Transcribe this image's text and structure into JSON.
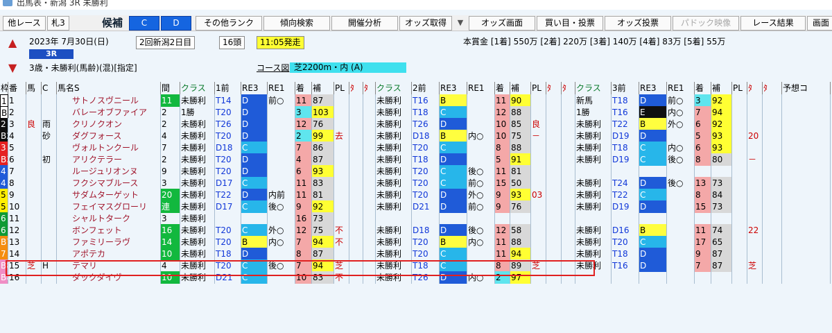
{
  "window_title": "出馬表・新潟 3R 未勝利",
  "toolbar": {
    "other": "他レース",
    "fuda": "札3",
    "kohol": "候補",
    "c": "C",
    "d": "D",
    "other_rank": "その他ランク",
    "trend": "傾向検索",
    "kaisai": "開催分析",
    "odds_get": "オッズ取得",
    "drop": "▼",
    "odds_screen": "オッズ画面",
    "buy": "買い目・投票",
    "odds_vote": "オッズ投票",
    "paddock": "パドック映像",
    "result": "レース結果",
    "screen": "画面"
  },
  "race": {
    "date": "2023年 7月30日(日)",
    "meet": "2回新潟2日目",
    "heads": "16頭",
    "start": "11:05発走",
    "racenum": "3R",
    "class": "3歳・未勝利(馬齢)(混)[指定]",
    "prize": "本賞金 [1着] 550万 [2着] 220万 [3着] 140万 [4着] 83万 [5着] 55万",
    "course_label": "コース図",
    "course": "芝2200m・内 (A)"
  },
  "columns": {
    "waku": "枠",
    "ban": "番",
    "kt": "馬",
    "c": "C",
    "name": "馬名S",
    "kan": "間",
    "class": "クラス",
    "prev1": "1前",
    "rei3": "RE3",
    "rei1": "RE1",
    "chaku": "着",
    "ho": "補",
    "pl": "PL",
    "g1": "ﾀ",
    "g2": "ﾀ",
    "class2": "クラス",
    "prev2": "2前",
    "rei3b": "RE3",
    "rei1b": "RE1",
    "chaku2": "着",
    "ho2": "補",
    "pl2": "PL",
    "g3": "ﾀ",
    "g4": "ﾀ",
    "class3": "クラス",
    "prev3": "3前",
    "rei3c": "RE3",
    "rei1c": "RE1",
    "chaku3": "着",
    "ho3": "補",
    "pl3": "PL",
    "g5": "ﾀ",
    "g6": "ﾀ",
    "yoso": "予想コ"
  },
  "rows": [
    {
      "waku": "1",
      "ban": "1",
      "kt": "",
      "c": "",
      "name": "サトノスヴニール",
      "kan": "11",
      "cls": "未勝利",
      "p": "T14",
      "r3": "D",
      "r1": "前○",
      "ch": "11",
      "ho": "87",
      "pl": "",
      "x": "",
      "cls2": "未勝利",
      "p2": "T16",
      "r3b": "B",
      "r1b": "",
      "ch2": "11",
      "ho2": "90",
      "pl2": "",
      "cls3": "新馬",
      "p3": "T18",
      "r3c": "D",
      "r1c": "前○",
      "ch3": "3",
      "ho3": "92",
      "x3": ""
    },
    {
      "waku": "B1",
      "ban": "2",
      "kt": "",
      "c": "",
      "name": "バレーオブファイア",
      "kan": "2",
      "cls": "1勝",
      "p": "T20",
      "r3": "D",
      "r1": "",
      "ch": "3",
      "ho": "103",
      "pl": "",
      "x": "",
      "cls2": "未勝利",
      "p2": "T18",
      "r3b": "C",
      "r1b": "",
      "ch2": "12",
      "ho2": "88",
      "pl2": "",
      "cls3": "1勝",
      "p3": "T16",
      "r3c": "E",
      "r1c": "内○",
      "ch3": "7",
      "ho3": "94",
      "x3": ""
    },
    {
      "waku": "2",
      "ban": "3",
      "kt": "良",
      "c": "雨",
      "name": "クリノクオン",
      "kan": "2",
      "cls": "未勝利",
      "p": "T26",
      "r3": "D",
      "r1": "",
      "ch": "12",
      "ho": "76",
      "pl": "",
      "x": "",
      "cls2": "未勝利",
      "p2": "T26",
      "r3b": "D",
      "r1b": "",
      "ch2": "10",
      "ho2": "85",
      "pl2": "良",
      "cls3": "未勝利",
      "p3": "T22",
      "r3c": "B",
      "r1c": "外○",
      "ch3": "6",
      "ho3": "92",
      "x3": ""
    },
    {
      "waku": "B2",
      "ban": "4",
      "kt": "",
      "c": "砂",
      "name": "ダグフォース",
      "kan": "4",
      "cls": "未勝利",
      "p": "T20",
      "r3": "D",
      "r1": "",
      "ch": "2",
      "ho": "99",
      "pl": "去",
      "x": "",
      "cls2": "未勝利",
      "p2": "D18",
      "r3b": "B",
      "r1b": "内○",
      "ch2": "10",
      "ho2": "75",
      "pl2": "－",
      "cls3": "未勝利",
      "p3": "D19",
      "r3c": "D",
      "r1c": "",
      "ch3": "5",
      "ho3": "93",
      "x3": "20"
    },
    {
      "waku": "3",
      "ban": "5",
      "kt": "",
      "c": "",
      "name": "ヴォルトンクール",
      "kan": "7",
      "cls": "未勝利",
      "p": "D18",
      "r3": "C",
      "r1": "",
      "ch": "7",
      "ho": "86",
      "pl": "",
      "x": "",
      "cls2": "未勝利",
      "p2": "T20",
      "r3b": "C",
      "r1b": "",
      "ch2": "8",
      "ho2": "88",
      "pl2": "",
      "cls3": "未勝利",
      "p3": "T18",
      "r3c": "C",
      "r1c": "内○",
      "ch3": "6",
      "ho3": "93",
      "x3": ""
    },
    {
      "waku": "B3",
      "ban": "6",
      "kt": "",
      "c": "初",
      "name": "アリクテラー",
      "kan": "2",
      "cls": "未勝利",
      "p": "T20",
      "r3": "D",
      "r1": "",
      "ch": "4",
      "ho": "87",
      "pl": "",
      "x": "",
      "cls2": "未勝利",
      "p2": "T18",
      "r3b": "D",
      "r1b": "",
      "ch2": "5",
      "ho2": "91",
      "pl2": "",
      "cls3": "未勝利",
      "p3": "D19",
      "r3c": "C",
      "r1c": "後○",
      "ch3": "8",
      "ho3": "80",
      "x3": "－"
    },
    {
      "waku": "4",
      "ban": "7",
      "kt": "",
      "c": "",
      "name": "ルージュリオンヌ",
      "kan": "9",
      "cls": "未勝利",
      "p": "T20",
      "r3": "D",
      "r1": "",
      "ch": "6",
      "ho": "93",
      "pl": "",
      "x": "",
      "cls2": "未勝利",
      "p2": "T20",
      "r3b": "C",
      "r1b": "後○",
      "ch2": "11",
      "ho2": "81",
      "pl2": "",
      "cls3": "",
      "p3": "",
      "r3c": "",
      "r1c": "",
      "ch3": "",
      "ho3": "",
      "x3": ""
    },
    {
      "waku": "4",
      "ban": "8",
      "kt": "",
      "c": "",
      "name": "フクシマブルース",
      "kan": "3",
      "cls": "未勝利",
      "p": "D17",
      "r3": "C",
      "r1": "",
      "ch": "11",
      "ho": "83",
      "pl": "",
      "x": "",
      "cls2": "未勝利",
      "p2": "T20",
      "r3b": "C",
      "r1b": "前○",
      "ch2": "15",
      "ho2": "50",
      "pl2": "",
      "cls3": "未勝利",
      "p3": "T24",
      "r3c": "D",
      "r1c": "後○",
      "ch3": "13",
      "ho3": "73",
      "x3": ""
    },
    {
      "waku": "5",
      "ban": "9",
      "kt": "",
      "c": "",
      "name": "サダムターゲット",
      "kan": "20",
      "cls": "未勝利",
      "p": "T22",
      "r3": "D",
      "r1": "内前",
      "ch": "11",
      "ho": "81",
      "pl": "",
      "x": "",
      "cls2": "未勝利",
      "p2": "T20",
      "r3b": "D",
      "r1b": "外○",
      "ch2": "9",
      "ho2": "93",
      "pl2": "03",
      "cls3": "未勝利",
      "p3": "T22",
      "r3c": "C",
      "r1c": "",
      "ch3": "8",
      "ho3": "84",
      "x3": ""
    },
    {
      "waku": "5",
      "ban": "10",
      "kt": "",
      "c": "",
      "name": "フェイマスグローリ",
      "kan": "連",
      "cls": "未勝利",
      "p": "D17",
      "r3": "C",
      "r1": "後○",
      "ch": "9",
      "ho": "92",
      "pl": "",
      "x": "",
      "cls2": "未勝利",
      "p2": "D21",
      "r3b": "D",
      "r1b": "前○",
      "ch2": "9",
      "ho2": "76",
      "pl2": "",
      "cls3": "未勝利",
      "p3": "D19",
      "r3c": "D",
      "r1c": "",
      "ch3": "15",
      "ho3": "73",
      "x3": ""
    },
    {
      "waku": "6",
      "ban": "11",
      "kt": "",
      "c": "",
      "name": "シャルトターク",
      "kan": "3",
      "cls": "未勝利",
      "p": "",
      "r3": "",
      "r1": "",
      "ch": "16",
      "ho": "73",
      "pl": "",
      "x": "",
      "cls2": "",
      "p2": "",
      "r3b": "",
      "r1b": "",
      "ch2": "",
      "ho2": "",
      "pl2": "",
      "cls3": "",
      "p3": "",
      "r3c": "",
      "r1c": "",
      "ch3": "",
      "ho3": "",
      "x3": ""
    },
    {
      "waku": "6",
      "ban": "12",
      "kt": "",
      "c": "",
      "name": "ボンフェット",
      "kan": "16",
      "cls": "未勝利",
      "p": "T20",
      "r3": "C",
      "r1": "外○",
      "ch": "12",
      "ho": "75",
      "pl": "不",
      "x": "",
      "cls2": "未勝利",
      "p2": "D18",
      "r3b": "D",
      "r1b": "後○",
      "ch2": "12",
      "ho2": "58",
      "pl2": "",
      "cls3": "未勝利",
      "p3": "D16",
      "r3c": "B",
      "r1c": "",
      "ch3": "11",
      "ho3": "74",
      "x3": "22"
    },
    {
      "waku": "B7",
      "ban": "13",
      "kt": "",
      "c": "",
      "name": "ファミリーラヴ",
      "kan": "14",
      "cls": "未勝利",
      "p": "T20",
      "r3": "B",
      "r1": "内○",
      "ch": "7",
      "ho": "94",
      "pl": "不",
      "x": "",
      "cls2": "未勝利",
      "p2": "T20",
      "r3b": "B",
      "r1b": "内○",
      "ch2": "11",
      "ho2": "88",
      "pl2": "",
      "cls3": "未勝利",
      "p3": "T20",
      "r3c": "C",
      "r1c": "",
      "ch3": "17",
      "ho3": "65",
      "x3": ""
    },
    {
      "waku": "7",
      "ban": "14",
      "kt": "",
      "c": "",
      "name": "アポテカ",
      "kan": "10",
      "cls": "未勝利",
      "p": "T18",
      "r3": "D",
      "r1": "",
      "ch": "8",
      "ho": "87",
      "pl": "",
      "x": "",
      "cls2": "未勝利",
      "p2": "T20",
      "r3b": "C",
      "r1b": "",
      "ch2": "11",
      "ho2": "94",
      "pl2": "",
      "cls3": "未勝利",
      "p3": "T18",
      "r3c": "D",
      "r1c": "",
      "ch3": "9",
      "ho3": "87",
      "x3": ""
    },
    {
      "waku": "B8",
      "ban": "15",
      "kt": "芝",
      "c": "H",
      "name": "テマリ",
      "kan": "4",
      "cls": "未勝利",
      "p": "T20",
      "r3": "C",
      "r1": "後○",
      "ch": "7",
      "ho": "94",
      "pl": "芝",
      "x": "",
      "cls2": "未勝利",
      "p2": "T18",
      "r3b": "C",
      "r1b": "",
      "ch2": "8",
      "ho2": "89",
      "pl2": "芝",
      "cls3": "未勝利",
      "p3": "T16",
      "r3c": "D",
      "r1c": "",
      "ch3": "7",
      "ho3": "87",
      "x3": "芝"
    },
    {
      "waku": "B8",
      "ban": "16",
      "kt": "",
      "c": "",
      "name": "ダックダイヴ",
      "kan": "10",
      "cls": "未勝利",
      "p": "D21",
      "r3": "C",
      "r1": "",
      "ch": "10",
      "ho": "83",
      "pl": "不",
      "x": "",
      "cls2": "未勝利",
      "p2": "T26",
      "r3b": "D",
      "r1b": "内○",
      "ch2": "2",
      "ho2": "97",
      "pl2": "",
      "cls3": "",
      "p3": "",
      "r3c": "",
      "r1c": "",
      "ch3": "",
      "ho3": "",
      "x3": ""
    }
  ]
}
